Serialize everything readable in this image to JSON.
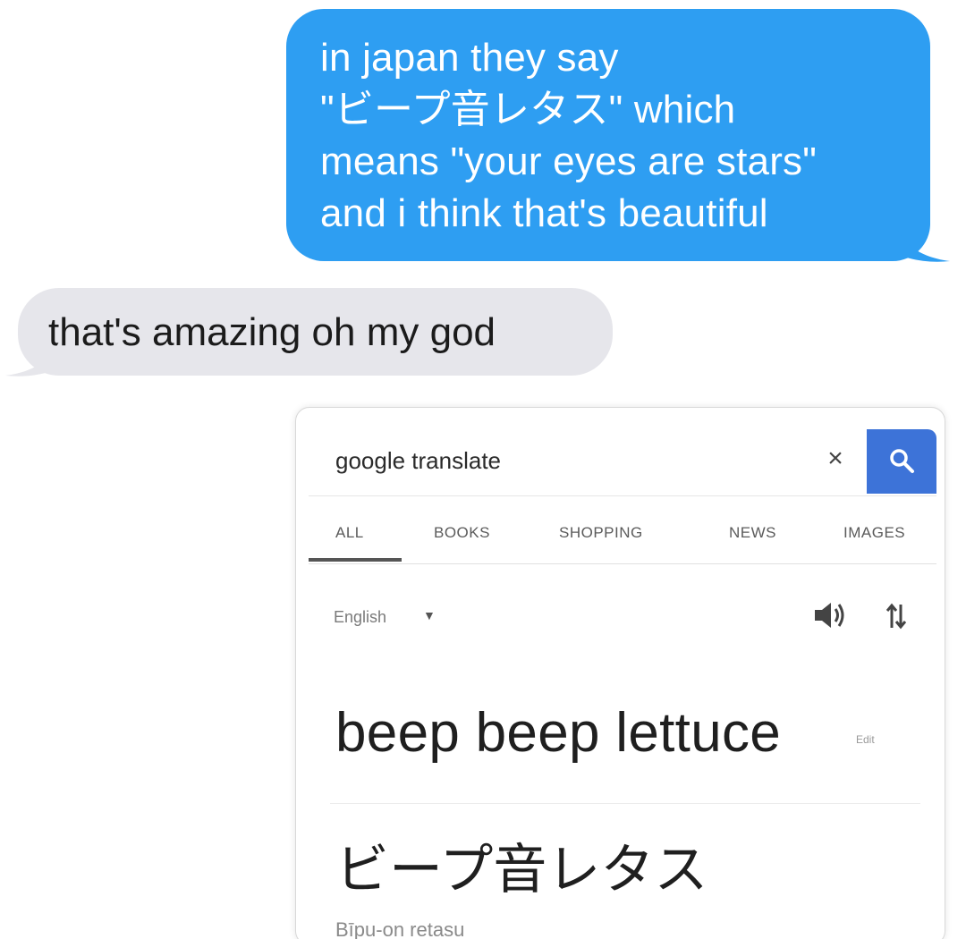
{
  "conversation": {
    "sent_message": {
      "lines": [
        "in japan they say",
        "\"ビープ音レタス\" which",
        "means \"your eyes are stars\"",
        "and i think that's beautiful"
      ],
      "color": "#2e9ef2"
    },
    "received_message": {
      "text": "that's amazing oh my god",
      "color": "#e6e6eb"
    }
  },
  "google_screenshot": {
    "search": {
      "query": "google translate",
      "clear_icon": "close-icon",
      "clear_glyph": "×",
      "search_icon": "search-icon",
      "button_color": "#3d73d8"
    },
    "tabs": [
      {
        "label": "ALL",
        "active": true
      },
      {
        "label": "BOOKS",
        "active": false
      },
      {
        "label": "SHOPPING",
        "active": false
      },
      {
        "label": "NEWS",
        "active": false
      },
      {
        "label": "IMAGES",
        "active": false
      }
    ],
    "translate": {
      "source_language": "English",
      "source_text": "beep beep lettuce",
      "edit_label": "Edit",
      "target_text": "ビープ音レタス",
      "romanization": "Bīpu-on retasu",
      "speaker_icon": "speaker-icon",
      "swap_icon": "swap-icon"
    }
  }
}
